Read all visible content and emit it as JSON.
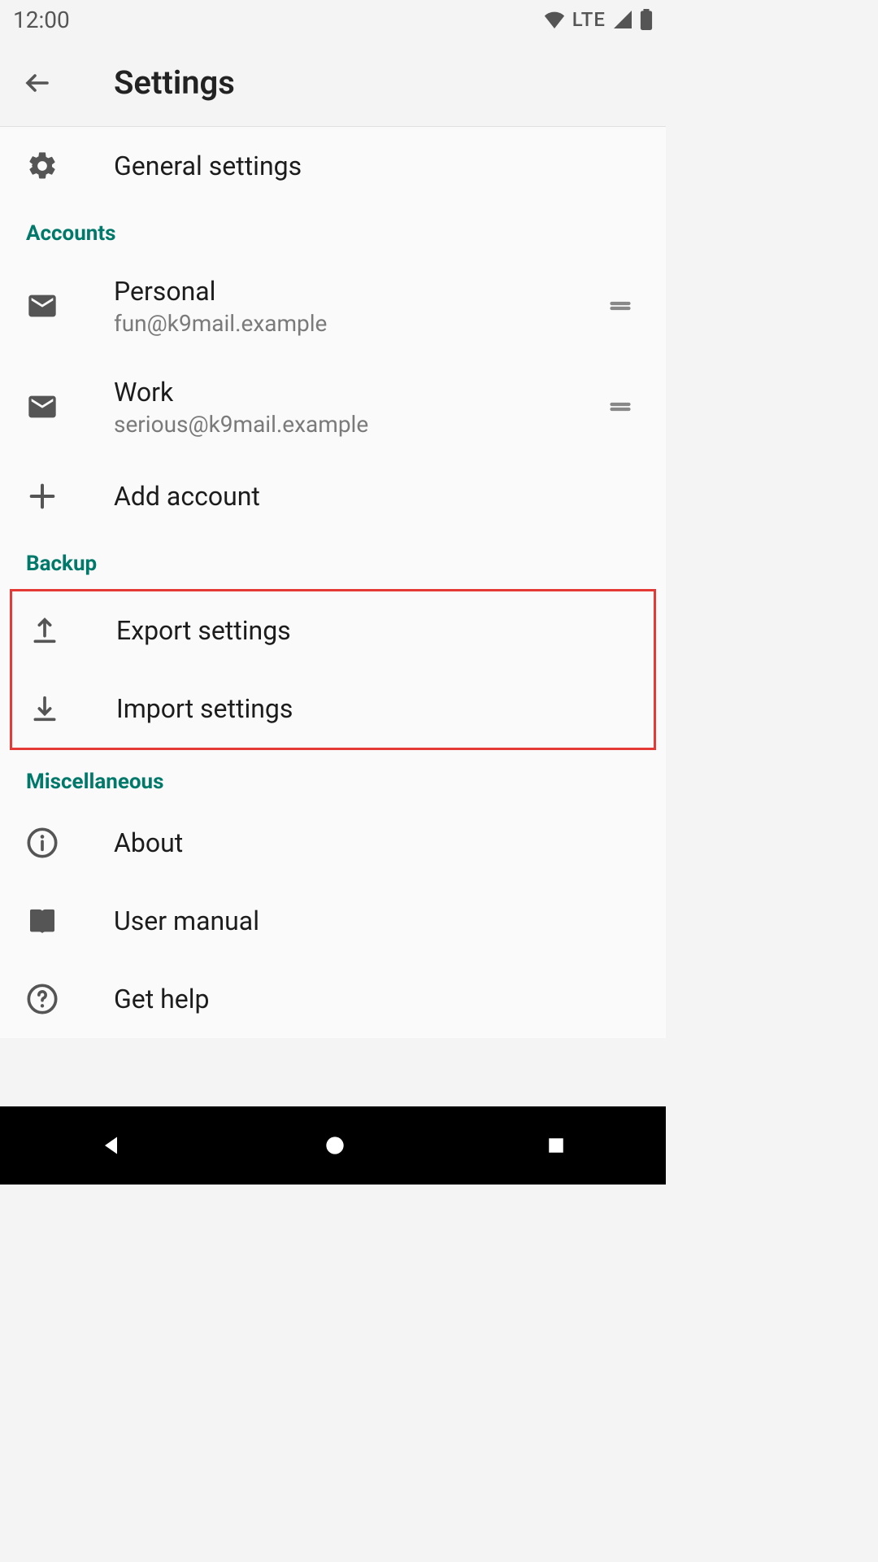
{
  "statusbar": {
    "time": "12:00",
    "cell": "LTE"
  },
  "appbar": {
    "title": "Settings"
  },
  "general": {
    "label": "General settings"
  },
  "sections": {
    "accounts_label": "Accounts",
    "backup_label": "Backup",
    "misc_label": "Miscellaneous"
  },
  "accounts": [
    {
      "name": "Personal",
      "email": "fun@k9mail.example"
    },
    {
      "name": "Work",
      "email": "serious@k9mail.example"
    }
  ],
  "add_account": {
    "label": "Add account"
  },
  "backup": {
    "export_label": "Export settings",
    "import_label": "Import settings"
  },
  "misc": {
    "about_label": "About",
    "manual_label": "User manual",
    "help_label": "Get help"
  }
}
